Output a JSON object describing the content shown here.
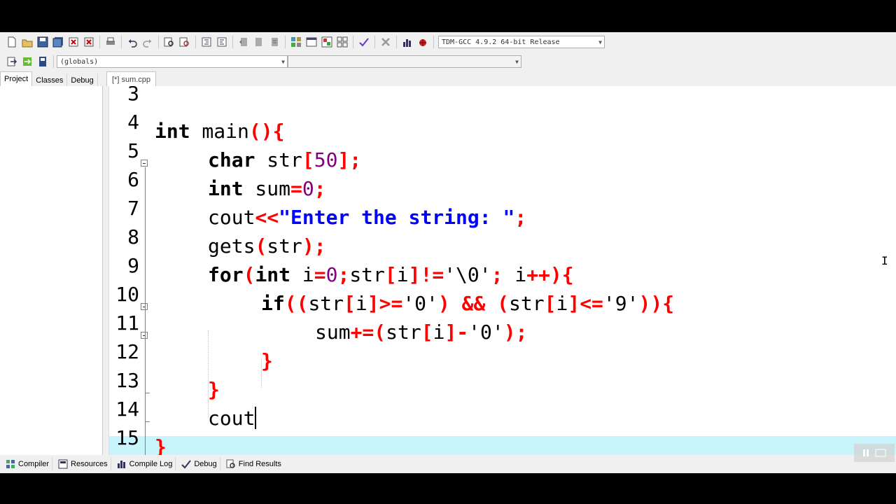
{
  "toolbar": {
    "compiler_select": "TDM-GCC 4.9.2 64-bit Release",
    "globals_select": "(globals)",
    "members_select": ""
  },
  "left_tabs": [
    {
      "label": "Project",
      "active": true
    },
    {
      "label": "Classes",
      "active": false
    },
    {
      "label": "Debug",
      "active": false
    }
  ],
  "editor_tab": {
    "label": "[*] sum.cpp"
  },
  "editor": {
    "lines": [
      {
        "num": "3"
      },
      {
        "num": "4"
      },
      {
        "num": "5"
      },
      {
        "num": "6"
      },
      {
        "num": "7"
      },
      {
        "num": "8"
      },
      {
        "num": "9"
      },
      {
        "num": "10"
      },
      {
        "num": "11"
      },
      {
        "num": "12"
      },
      {
        "num": "13"
      },
      {
        "num": "14"
      },
      {
        "num": "15"
      }
    ],
    "code": {
      "l4": {
        "kw_int": "int",
        "id_main": " main",
        "sym_open": "(){"
      },
      "l5": {
        "kw_char": "char",
        "id_str": " str",
        "sym_lb": "[",
        "num_50": "50",
        "sym_rb": "];"
      },
      "l6": {
        "kw_int": "int",
        "id_sum": " sum",
        "sym_eq": "=",
        "num_0": "0",
        "sym_semi": ";"
      },
      "l7": {
        "id_cout": "cout",
        "sym_shift": "<<",
        "str_prompt": "\"Enter the string: \"",
        "sym_semi": ";"
      },
      "l8": {
        "id_gets": "gets",
        "sym_lp": "(",
        "id_str": "str",
        "sym_rp": ");"
      },
      "l9": {
        "kw_for": "for",
        "sym_lp": "(",
        "kw_int": "int",
        "id_i": " i",
        "sym_eq": "=",
        "num_0": "0",
        "sym_semi1": ";",
        "id_str": "str",
        "sym_lb": "[",
        "id_i2": "i",
        "sym_rb": "]!=",
        "chr_nul": "'\\0'",
        "sym_semi2": "; ",
        "id_i3": "i",
        "sym_inc": "++){"
      },
      "l10": {
        "kw_if": "if",
        "sym_lp": "((",
        "id_str": "str",
        "sym_lb": "[",
        "id_i": "i",
        "sym_rb": "]>=",
        "chr_0": "'0'",
        "sym_and": ") && (",
        "id_str2": "str",
        "sym_lb2": "[",
        "id_i2": "i",
        "sym_rb2": "]<=",
        "chr_9": "'9'",
        "sym_close": ")){"
      },
      "l11": {
        "id_sum": "sum",
        "sym_pe": "+=(",
        "id_str": "str",
        "sym_lb": "[",
        "id_i": "i",
        "sym_rb": "]-",
        "chr_0": "'0'",
        "sym_close": ");"
      },
      "l12": {
        "sym_brace": "}"
      },
      "l13": {
        "sym_brace": "}"
      },
      "l14": {
        "id_cout": "cout"
      },
      "l15": {
        "sym_brace": "}"
      }
    }
  },
  "bottom_tabs": [
    {
      "label": "Compiler",
      "icon": "compiler-grid-icon"
    },
    {
      "label": "Resources",
      "icon": "resources-icon"
    },
    {
      "label": "Compile Log",
      "icon": "compile-log-chart-icon"
    },
    {
      "label": "Debug",
      "icon": "debug-check-icon"
    },
    {
      "label": "Find Results",
      "icon": "find-results-icon"
    }
  ],
  "colors": {
    "keyword": "#000000",
    "symbol": "#ff0000",
    "string": "#0000ff",
    "number": "#800080",
    "active_line": "#caf4fc"
  }
}
